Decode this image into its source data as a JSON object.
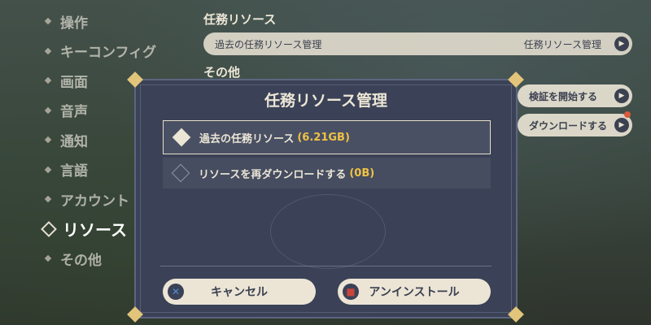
{
  "nav": {
    "items": [
      {
        "label": "操作"
      },
      {
        "label": "キーコンフィグ"
      },
      {
        "label": "画面"
      },
      {
        "label": "音声"
      },
      {
        "label": "通知"
      },
      {
        "label": "言語"
      },
      {
        "label": "アカウント"
      },
      {
        "label": "リソース"
      },
      {
        "label": "その他"
      }
    ],
    "active": "リソース"
  },
  "settings": {
    "section_quest": "任務リソース",
    "row_label": "過去の任務リソース管理",
    "row_value": "任務リソース管理",
    "section_other": "その他",
    "verify_button": "検証を開始する",
    "download_button": "ダウンロードする"
  },
  "dialog": {
    "title": "任務リソース管理",
    "option1_label": "過去の任務リソース",
    "option1_size": "(6.21GB)",
    "option2_label": "リソースを再ダウンロードする",
    "option2_size": "(0B)",
    "cancel_label": "キャンセル",
    "uninstall_label": "アンインストール"
  },
  "colors": {
    "accent_yellow": "#f0c145",
    "dialog_bg": "#3b4257",
    "button_bg": "#ece5d6",
    "cancel_icon": "#4a8fd8",
    "uninstall_icon": "#c9443a"
  }
}
